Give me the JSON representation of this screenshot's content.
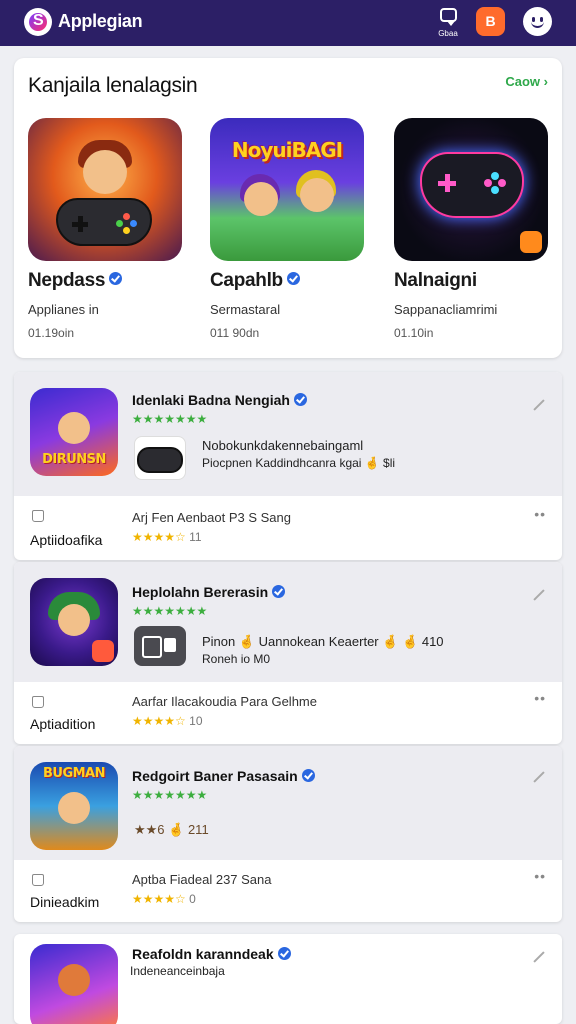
{
  "topbar": {
    "app_title": "Applegian",
    "chat_label": "Gbaa",
    "bag_label": "B"
  },
  "featured": {
    "title": "Kanjaila lenalagsin",
    "see_all": "Caow",
    "items": [
      {
        "name": "Nepdass",
        "subtitle": "Applianes in",
        "meta": "01.19oin"
      },
      {
        "name": "Capahlb",
        "subtitle": "Sermastaral",
        "meta": "011 90dn",
        "art_title": "NoyuiBAGI"
      },
      {
        "name": "Nalnaigni",
        "subtitle": "Sappanacliamrimi",
        "meta": "01.10in"
      }
    ]
  },
  "list": [
    {
      "title": "Idenlaki Badna Nengiah",
      "green_stars": "★★★★★★★",
      "icon_text": "DIRUNSN",
      "desc1": "Nobokunkdakennebaingaml",
      "desc2": "Piocpnen Kaddindhcanra kgai 🤞 $li",
      "bottom_sub": "Arj Fen Aenbaot P3 S Sang",
      "bottom_stars": "★★★★☆",
      "bottom_count": "11",
      "bottom_label": "Aptiidoafika"
    },
    {
      "title": "Heplolahn Bererasin",
      "green_stars": "★★★★★★★",
      "desc1": "Pinon 🤞 Uannokean Keaerter 🤞 🤞 410",
      "desc2": "Roneh io M0",
      "bottom_sub": "Aarfar Ilacakoudia Para Gelhme",
      "bottom_stars": "★★★★☆",
      "bottom_count": "10",
      "bottom_label": "Aptiadition"
    },
    {
      "title": "Redgoirt Baner Pasasain",
      "green_stars": "★★★★★★★",
      "icon_text": "BUGMAN",
      "desc1": "★★6 🤞 211",
      "bottom_sub": "Aptba Fiadeal 237 Sana",
      "bottom_stars": "★★★★☆",
      "bottom_count": "0",
      "bottom_label": "Dinieadkim"
    },
    {
      "title": "Reafoldn karanndeak",
      "subtitle": "Indeneanceinbaja"
    }
  ],
  "colors": {
    "topbar": "#2c1f66",
    "accent_green": "#2ea84a",
    "bag_orange": "#ff6b2c",
    "verified_blue": "#2a67e0",
    "star_yellow": "#f0b400"
  }
}
